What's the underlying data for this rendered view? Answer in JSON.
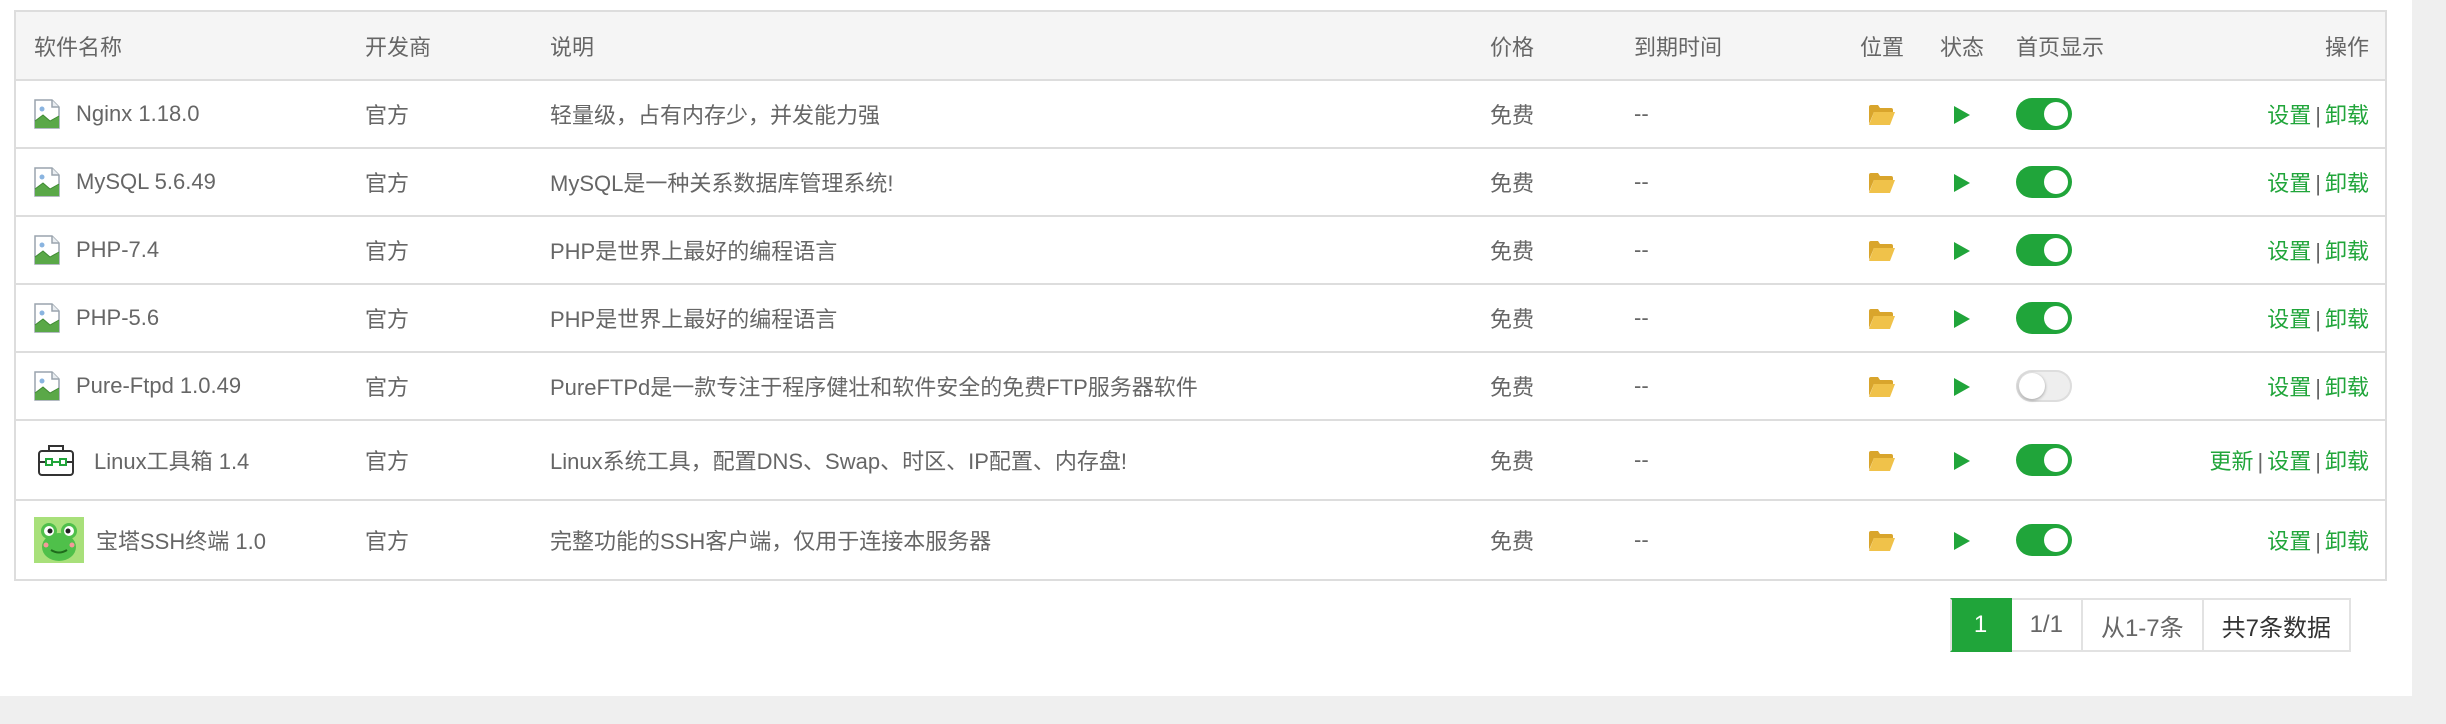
{
  "headers": {
    "name": "软件名称",
    "developer": "开发商",
    "description": "说明",
    "price": "价格",
    "expire": "到期时间",
    "position": "位置",
    "status": "状态",
    "homepage": "首页显示",
    "operations": "操作"
  },
  "rows": [
    {
      "name": "Nginx 1.18.0",
      "icon": "broken-image-icon",
      "developer": "官方",
      "description": "轻量级，占有内存少，并发能力强",
      "price": "免费",
      "expire": "--",
      "homepage_on": true,
      "ops": [
        "设置",
        "卸载"
      ]
    },
    {
      "name": "MySQL 5.6.49",
      "icon": "broken-image-icon",
      "developer": "官方",
      "description": "MySQL是一种关系数据库管理系统!",
      "price": "免费",
      "expire": "--",
      "homepage_on": true,
      "ops": [
        "设置",
        "卸载"
      ]
    },
    {
      "name": "PHP-7.4",
      "icon": "broken-image-icon",
      "developer": "官方",
      "description": "PHP是世界上最好的编程语言",
      "price": "免费",
      "expire": "--",
      "homepage_on": true,
      "ops": [
        "设置",
        "卸载"
      ]
    },
    {
      "name": "PHP-5.6",
      "icon": "broken-image-icon",
      "developer": "官方",
      "description": "PHP是世界上最好的编程语言",
      "price": "免费",
      "expire": "--",
      "homepage_on": true,
      "ops": [
        "设置",
        "卸载"
      ]
    },
    {
      "name": "Pure-Ftpd 1.0.49",
      "icon": "broken-image-icon",
      "developer": "官方",
      "description": "PureFTPd是一款专注于程序健壮和软件安全的免费FTP服务器软件",
      "price": "免费",
      "expire": "--",
      "homepage_on": false,
      "ops": [
        "设置",
        "卸载"
      ]
    },
    {
      "name": "Linux工具箱 1.4",
      "icon": "toolbox-icon",
      "developer": "官方",
      "description": "Linux系统工具，配置DNS、Swap、时区、IP配置、内存盘!",
      "price": "免费",
      "expire": "--",
      "homepage_on": true,
      "ops": [
        "更新",
        "设置",
        "卸载"
      ]
    },
    {
      "name": "宝塔SSH终端 1.0",
      "icon": "frog-icon",
      "developer": "官方",
      "description": "完整功能的SSH客户端，仅用于连接本服务器",
      "price": "免费",
      "expire": "--",
      "homepage_on": true,
      "ops": [
        "设置",
        "卸载"
      ]
    }
  ],
  "pagination": {
    "current_page": "1",
    "page_info": "1/1",
    "range": "从1-7条",
    "total": "共7条数据"
  },
  "colors": {
    "accent": "#20a53a",
    "folder": "#e8b93a",
    "text": "#666666"
  }
}
